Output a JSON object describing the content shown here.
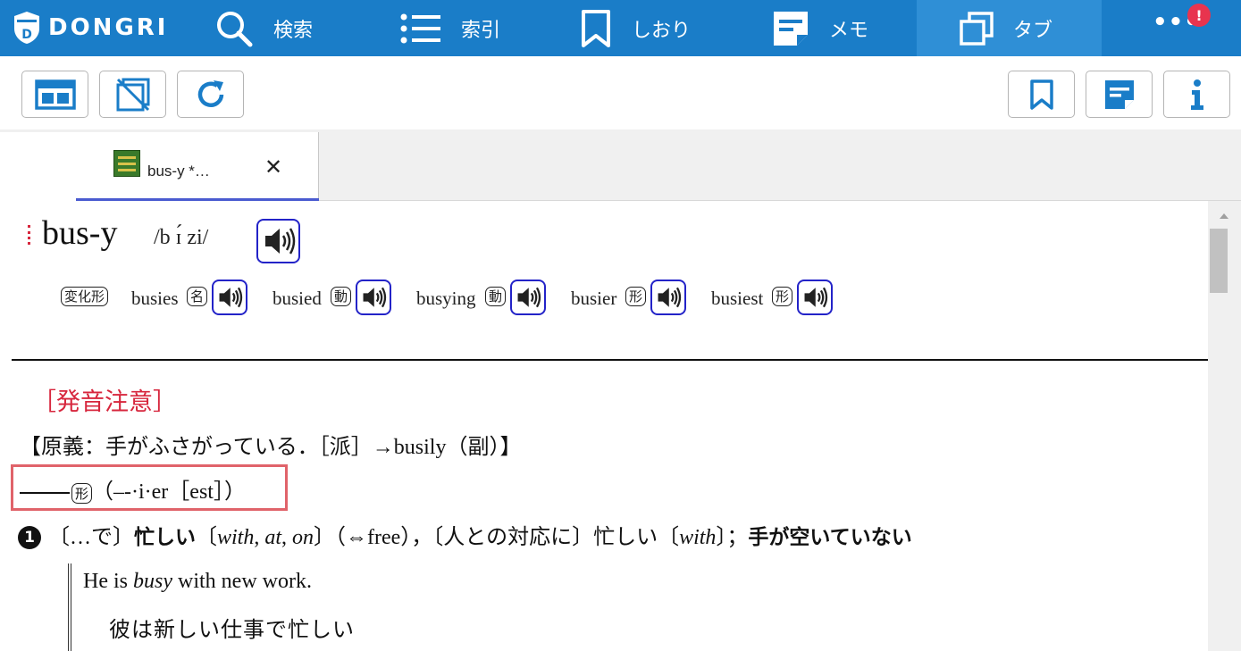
{
  "app": {
    "logo_text": "DONGRI",
    "brand_color": "#1a7dc8"
  },
  "nav": {
    "search_label": "検索",
    "index_label": "索引",
    "bookmark_label": "しおり",
    "memo_label": "メモ",
    "tabs_label": "タブ",
    "more_label": "•••",
    "badge": "!"
  },
  "toolbar": {
    "left_icons": [
      "layout-icon",
      "no-image-icon",
      "refresh-icon"
    ],
    "right_icons": [
      "bookmark-icon",
      "memo-icon",
      "info-icon"
    ]
  },
  "tab": {
    "label": "bus-y *…",
    "close": "✕"
  },
  "entry": {
    "headword": "bus-y",
    "pronunciation": "/b ɪ́ zi/",
    "inflection_tag": "変化形",
    "inflections": [
      {
        "word": "busies",
        "pos": "名"
      },
      {
        "word": "busied",
        "pos": "動"
      },
      {
        "word": "busying",
        "pos": "動"
      },
      {
        "word": "busier",
        "pos": "形"
      },
      {
        "word": "busiest",
        "pos": "形"
      }
    ],
    "pronunciation_note": "［発音注意］",
    "origin": "【原義：手がふさがっている．［派］→busily（副）】",
    "form_pos": "形",
    "form_text": "（–-·i·er［est］）",
    "sense": {
      "number": "1",
      "part1": "〔…で〕",
      "bold1": "忙しい",
      "part2": "〔",
      "prep1": "with",
      "comma1": ", ",
      "prep2": "at",
      "comma2": ", ",
      "prep3": "on",
      "part3": "〕（⇔free），〔人との対応に〕忙しい〔",
      "prep4": "with",
      "part4": "〕；",
      "bold2": "手が空いていない"
    },
    "example": {
      "en_before": "He is ",
      "en_italic": "busy",
      "en_after": " with new work.",
      "ja": "彼は新しい仕事で忙しい"
    }
  }
}
